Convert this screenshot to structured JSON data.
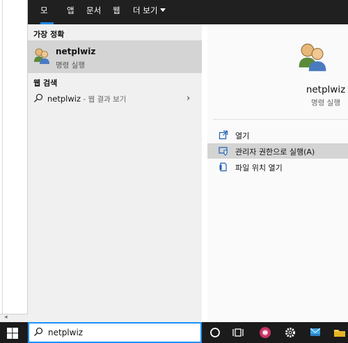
{
  "tabs": [
    {
      "label": "모두",
      "active": true
    },
    {
      "label": "앱"
    },
    {
      "label": "문서"
    },
    {
      "label": "웹"
    },
    {
      "label": "더 보기"
    }
  ],
  "results": {
    "best_match_header": "가장 정확",
    "best_match": {
      "name": "netplwiz",
      "type": "명령 실행",
      "icon": "users-icon"
    },
    "web_header": "웹 검색",
    "web_item": {
      "query": "netplwiz",
      "suffix": " - 웹 결과 보기"
    }
  },
  "detail": {
    "title": "netplwiz",
    "subtitle": "명령 실행",
    "actions": [
      {
        "label": "열기",
        "icon": "open-icon"
      },
      {
        "label": "관리자 권한으로 실행(A)",
        "icon": "shield-icon",
        "highlighted": true
      },
      {
        "label": "파일 위치 열기",
        "icon": "file-location-icon"
      }
    ]
  },
  "taskbar": {
    "search_value": "netplwiz",
    "icons": [
      "windows-start-icon",
      "search-icon",
      "cortana-icon",
      "task-view-icon",
      "app-icon",
      "settings-icon",
      "mail-icon",
      "file-explorer-icon"
    ]
  },
  "colors": {
    "accent": "#1e88e5",
    "dark": "#202020",
    "highlight": "#d4d4d4"
  }
}
